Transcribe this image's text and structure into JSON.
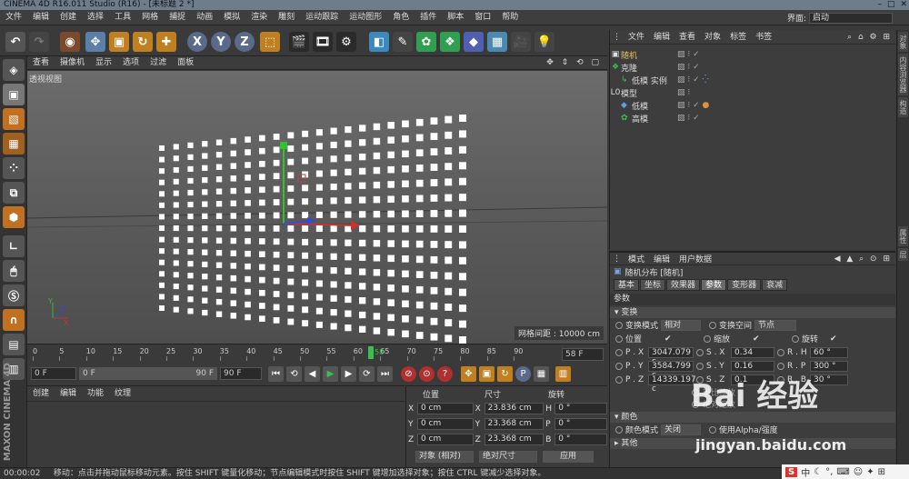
{
  "window": {
    "title": "CINEMA 4D R16.011 Studio (R16) - [未标题 2 *]"
  },
  "menubar": {
    "items": [
      "文件",
      "编辑",
      "创建",
      "选择",
      "工具",
      "网格",
      "捕捉",
      "动画",
      "模拟",
      "渲染",
      "雕刻",
      "运动跟踪",
      "运动图形",
      "角色",
      "插件",
      "脚本",
      "窗口",
      "帮助"
    ],
    "layout_label": "界面:",
    "layout_value": "启动"
  },
  "toolbar": {
    "x_label": "X",
    "y_label": "Y",
    "z_label": "Z"
  },
  "viewport": {
    "menu": [
      "查看",
      "摄像机",
      "显示",
      "选项",
      "过滤",
      "面板"
    ],
    "label": "透视视图",
    "grid_info": "网格间距 : 10000 cm"
  },
  "timeline": {
    "ticks": [
      "0",
      "5",
      "10",
      "15",
      "20",
      "25",
      "30",
      "35",
      "40",
      "45",
      "50",
      "55",
      "60",
      "65",
      "70",
      "75",
      "80",
      "85",
      "90"
    ],
    "current": "58",
    "current_frame": "58 F"
  },
  "transport": {
    "start": "0 F",
    "range_start": "0 F",
    "range_end": "90 F",
    "end": "90 F"
  },
  "material_manager": {
    "menu": [
      "创建",
      "编辑",
      "功能",
      "纹理"
    ]
  },
  "coordinates": {
    "headers": {
      "pos": "位置",
      "size": "尺寸",
      "rot": "旋转"
    },
    "rows": [
      {
        "axis": "X",
        "pos": "0 cm",
        "size_axis": "X",
        "size": "23.836 cm",
        "rot_axis": "H",
        "rot": "0 °"
      },
      {
        "axis": "Y",
        "pos": "0 cm",
        "size_axis": "Y",
        "size": "23.368 cm",
        "rot_axis": "P",
        "rot": "0 °"
      },
      {
        "axis": "Z",
        "pos": "0 cm",
        "size_axis": "Z",
        "size": "23.368 cm",
        "rot_axis": "B",
        "rot": "0 °"
      }
    ],
    "mode": "对象 (相对)",
    "size_mode": "绝对尺寸",
    "apply": "应用"
  },
  "object_manager": {
    "menu": [
      "文件",
      "编辑",
      "查看",
      "对象",
      "标签",
      "书签"
    ],
    "objects": [
      {
        "name": "随机",
        "indent": 0,
        "color": "#e8c060"
      },
      {
        "name": "克隆",
        "indent": 0,
        "color": "#dddddd"
      },
      {
        "name": "低模 实例",
        "indent": 1,
        "color": "#dddddd"
      },
      {
        "name": "模型",
        "indent": 0,
        "color": "#dddddd"
      },
      {
        "name": "低模",
        "indent": 1,
        "color": "#dddddd"
      },
      {
        "name": "高模",
        "indent": 1,
        "color": "#dddddd"
      }
    ]
  },
  "attributes": {
    "menu": [
      "模式",
      "编辑",
      "用户数据"
    ],
    "object_title": "随机分布 [随机]",
    "tabs": [
      "基本",
      "坐标",
      "效果器",
      "参数",
      "变形器",
      "衰减"
    ],
    "active_tab": "参数",
    "params_label": "参数",
    "section_transform": "变换",
    "transform_mode_label": "变换模式",
    "transform_mode_value": "相对",
    "transform_space_label": "变换空间",
    "transform_space_value": "节点",
    "position_label": "位置",
    "scale_label": "缩放",
    "rotate_label": "旋转",
    "p_rows": [
      {
        "label": "P . X",
        "value": "3047.079 c",
        "s_label": "S . X",
        "s_value": "0.34",
        "r_label": "R . H",
        "r_value": "60 °"
      },
      {
        "label": "P . Y",
        "value": "3584.799 c",
        "s_label": "S . Y",
        "s_value": "0.16",
        "r_label": "R . P",
        "r_value": "300 °"
      },
      {
        "label": "P . Z",
        "value": "14339.197 c",
        "s_label": "S . Z",
        "s_value": "0.1",
        "r_label": "R . B",
        "r_value": "30 °"
      }
    ],
    "uniform_scale": "等比缩放",
    "absolute_scale": "绝对缩放",
    "section_color": "颜色",
    "color_mode_label": "颜色模式",
    "color_mode_value": "关闭",
    "alpha_label": "使用Alpha/强度",
    "section_other": "其他"
  },
  "side_tabs": [
    "对象",
    "内容浏览器",
    "构造",
    "属性",
    "层"
  ],
  "statusbar": {
    "time": "00:00:02",
    "message": "移动：点击并拖动鼠标移动元素。按住 SHIFT 键量化移动；节点编辑模式时按住 SHIFT 键增加选择对象；按住 CTRL 键减少选择对象。"
  },
  "watermark": {
    "text": "Bai 经验",
    "url": "jingyan.baidu.com"
  },
  "tray": {
    "ime": "中"
  },
  "brand": {
    "maxon": "MAXON",
    "c4d": "CINEMA 4D"
  },
  "colors": {
    "accent": "#5a7fa8",
    "axis_x": "#d03030",
    "axis_y": "#30c030",
    "axis_z": "#3050d0"
  }
}
